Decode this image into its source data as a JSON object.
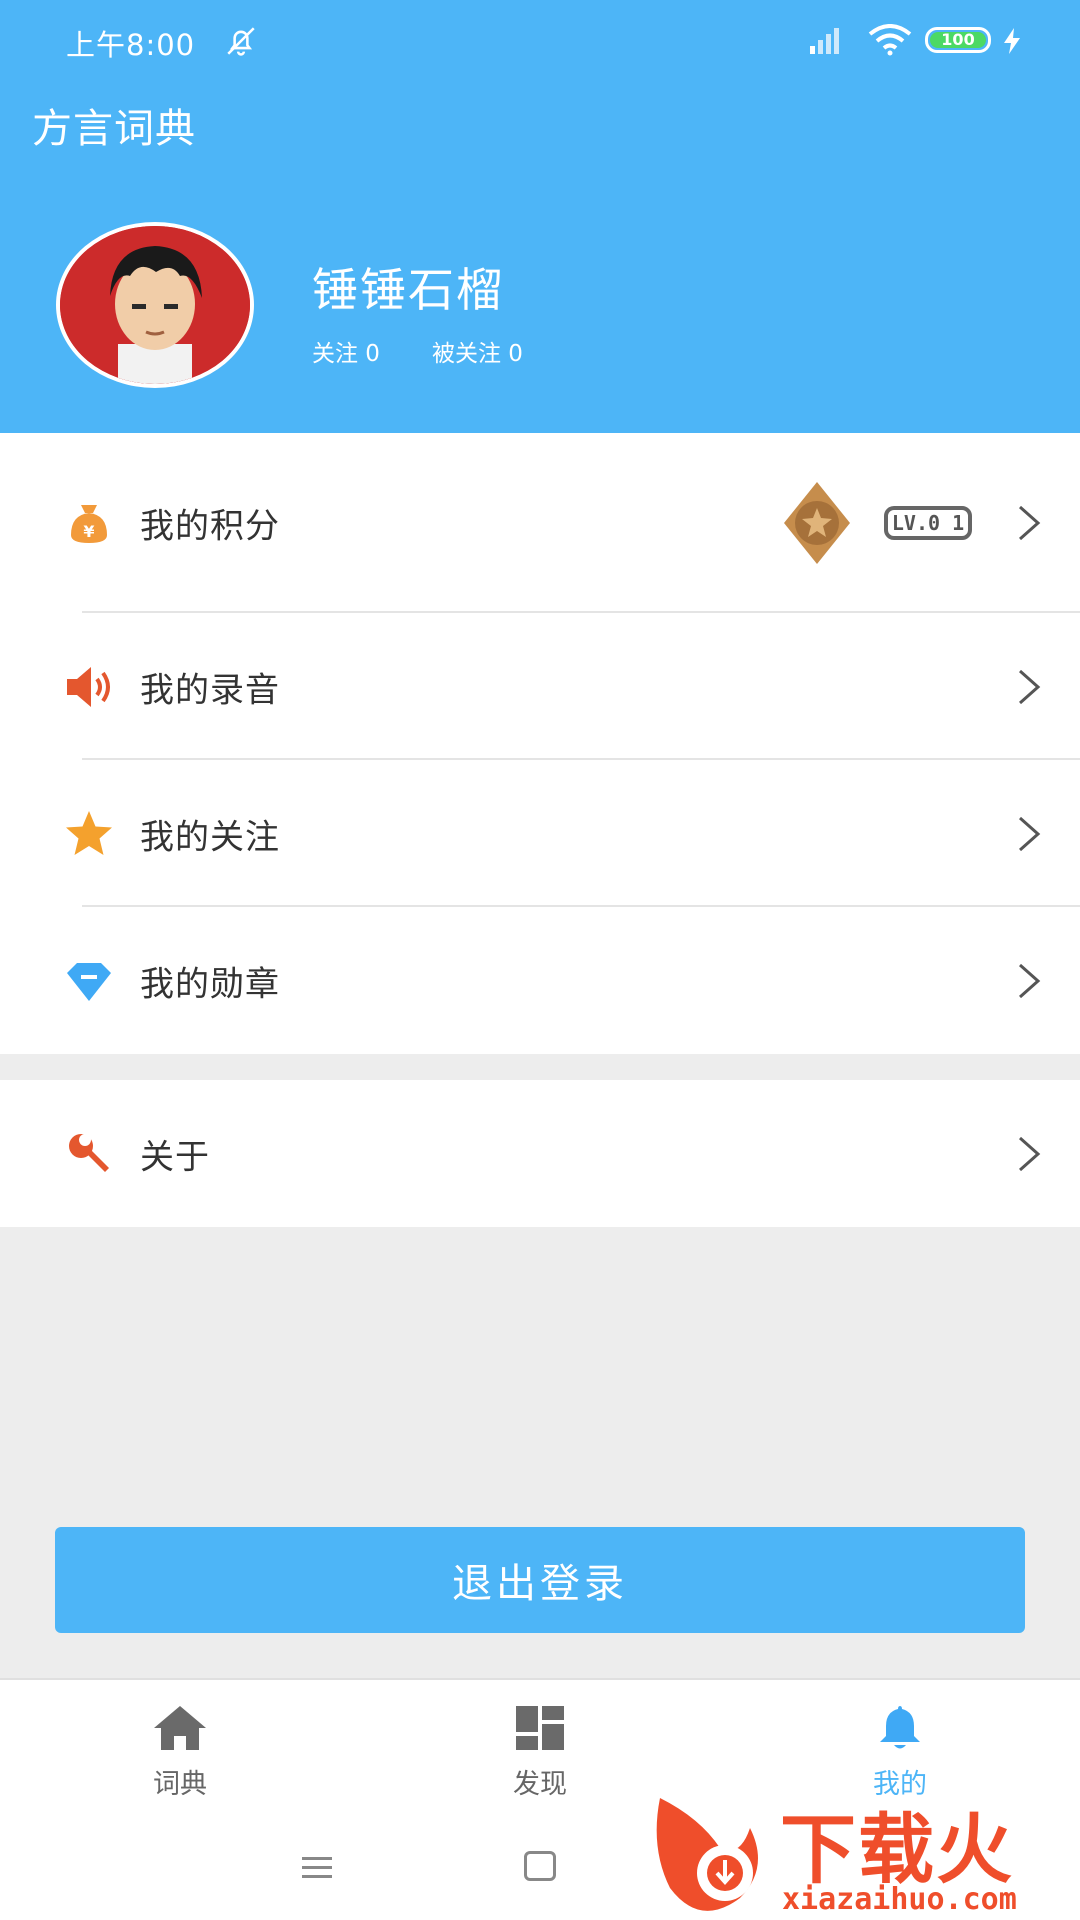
{
  "status_bar": {
    "time": "上午8:00",
    "battery": "100"
  },
  "header": {
    "app_title": "方言词典",
    "username": "锤锤石榴",
    "following_label": "关注 0",
    "followers_label": "被关注 0"
  },
  "menu": {
    "items": [
      {
        "label": "我的积分",
        "icon": "money-bag-icon"
      },
      {
        "label": "我的录音",
        "icon": "speaker-icon"
      },
      {
        "label": "我的关注",
        "icon": "star-icon"
      },
      {
        "label": "我的勋章",
        "icon": "diamond-icon"
      }
    ],
    "level_badge": "LV.0 1",
    "about": {
      "label": "关于",
      "icon": "wrench-icon"
    }
  },
  "logout_label": "退出登录",
  "bottom_nav": {
    "items": [
      {
        "label": "词典",
        "icon": "home-icon",
        "active": false
      },
      {
        "label": "发现",
        "icon": "grid-icon",
        "active": false
      },
      {
        "label": "我的",
        "icon": "bell-icon",
        "active": true
      }
    ]
  },
  "watermark": {
    "brand": "下载火",
    "url": "xiazaihuo.com"
  },
  "colors": {
    "accent": "#4db5f7",
    "background": "#ededed",
    "watermark": "#ef4e2b"
  }
}
